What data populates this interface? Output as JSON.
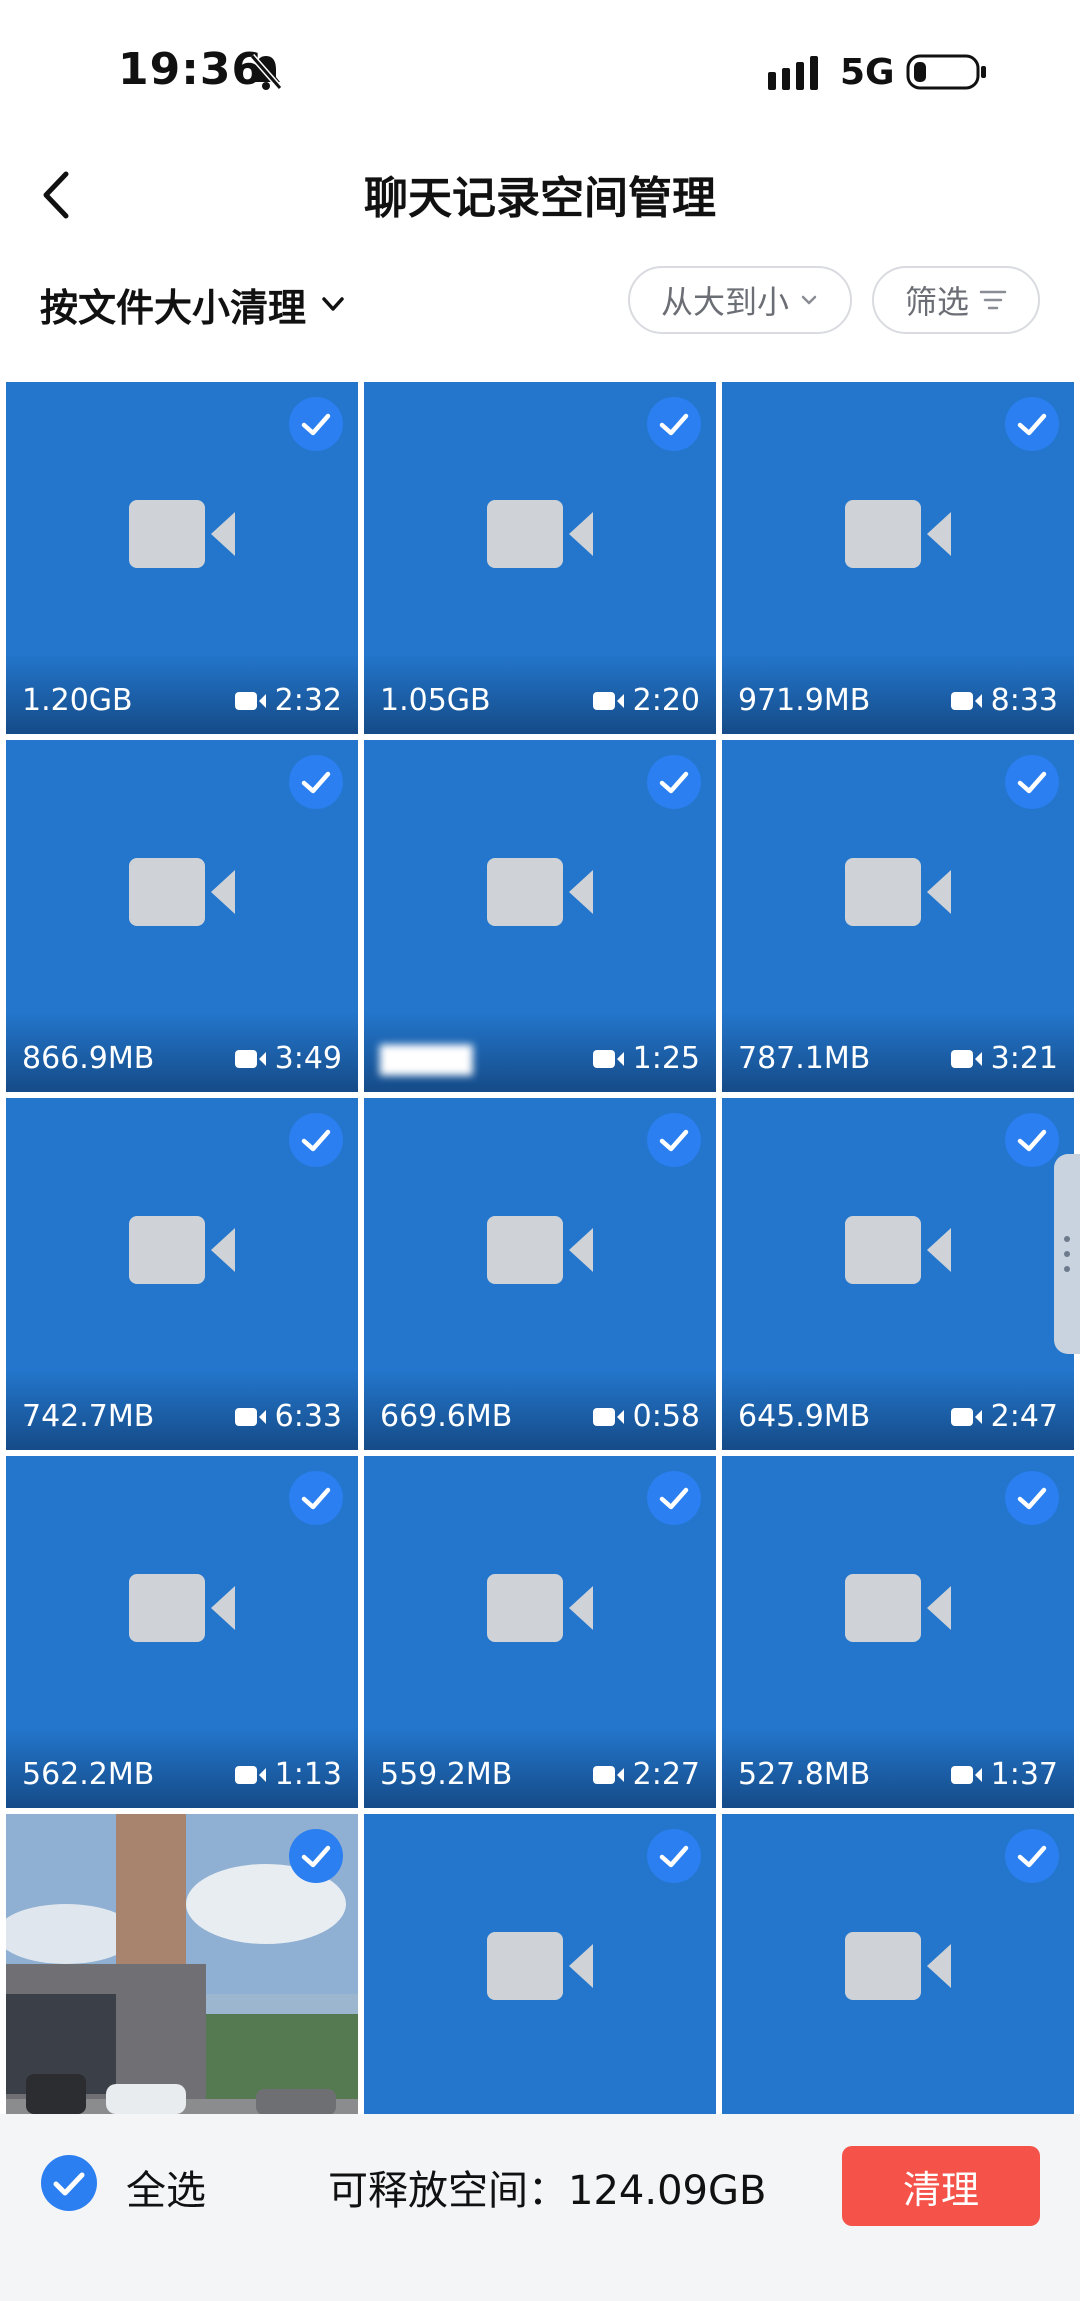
{
  "status_bar": {
    "time": "19:36",
    "network": "5G"
  },
  "header": {
    "title": "聊天记录空间管理"
  },
  "filter_bar": {
    "sort_mode": "按文件大小清理",
    "order": "从大到小",
    "filter": "筛选"
  },
  "files": [
    {
      "size": "1.20GB",
      "duration": "2:32",
      "type": "video",
      "checked": true
    },
    {
      "size": "1.05GB",
      "duration": "2:20",
      "type": "video",
      "checked": true
    },
    {
      "size": "971.9MB",
      "duration": "8:33",
      "type": "video",
      "checked": true
    },
    {
      "size": "866.9MB",
      "duration": "3:49",
      "type": "video",
      "checked": true
    },
    {
      "size": "",
      "duration": "1:25",
      "type": "video",
      "checked": true,
      "size_blurred": true
    },
    {
      "size": "787.1MB",
      "duration": "3:21",
      "type": "video",
      "checked": true
    },
    {
      "size": "742.7MB",
      "duration": "6:33",
      "type": "video",
      "checked": true
    },
    {
      "size": "669.6MB",
      "duration": "0:58",
      "type": "video",
      "checked": true
    },
    {
      "size": "645.9MB",
      "duration": "2:47",
      "type": "video",
      "checked": true
    },
    {
      "size": "562.2MB",
      "duration": "1:13",
      "type": "video",
      "checked": true
    },
    {
      "size": "559.2MB",
      "duration": "2:27",
      "type": "video",
      "checked": true
    },
    {
      "size": "527.8MB",
      "duration": "1:37",
      "type": "video",
      "checked": true
    },
    {
      "size": "",
      "duration": "",
      "type": "photo",
      "checked": true
    },
    {
      "size": "",
      "duration": "",
      "type": "video",
      "checked": true
    },
    {
      "size": "",
      "duration": "",
      "type": "video",
      "checked": true
    }
  ],
  "bottom_bar": {
    "select_all_label": "全选",
    "free_space_label": "可释放空间：",
    "free_space_value": "124.09GB",
    "clean_label": "清理"
  },
  "colors": {
    "tile_blue": "#2376cc",
    "check_blue": "#2b7ff0",
    "clean_red": "#f5524a"
  }
}
